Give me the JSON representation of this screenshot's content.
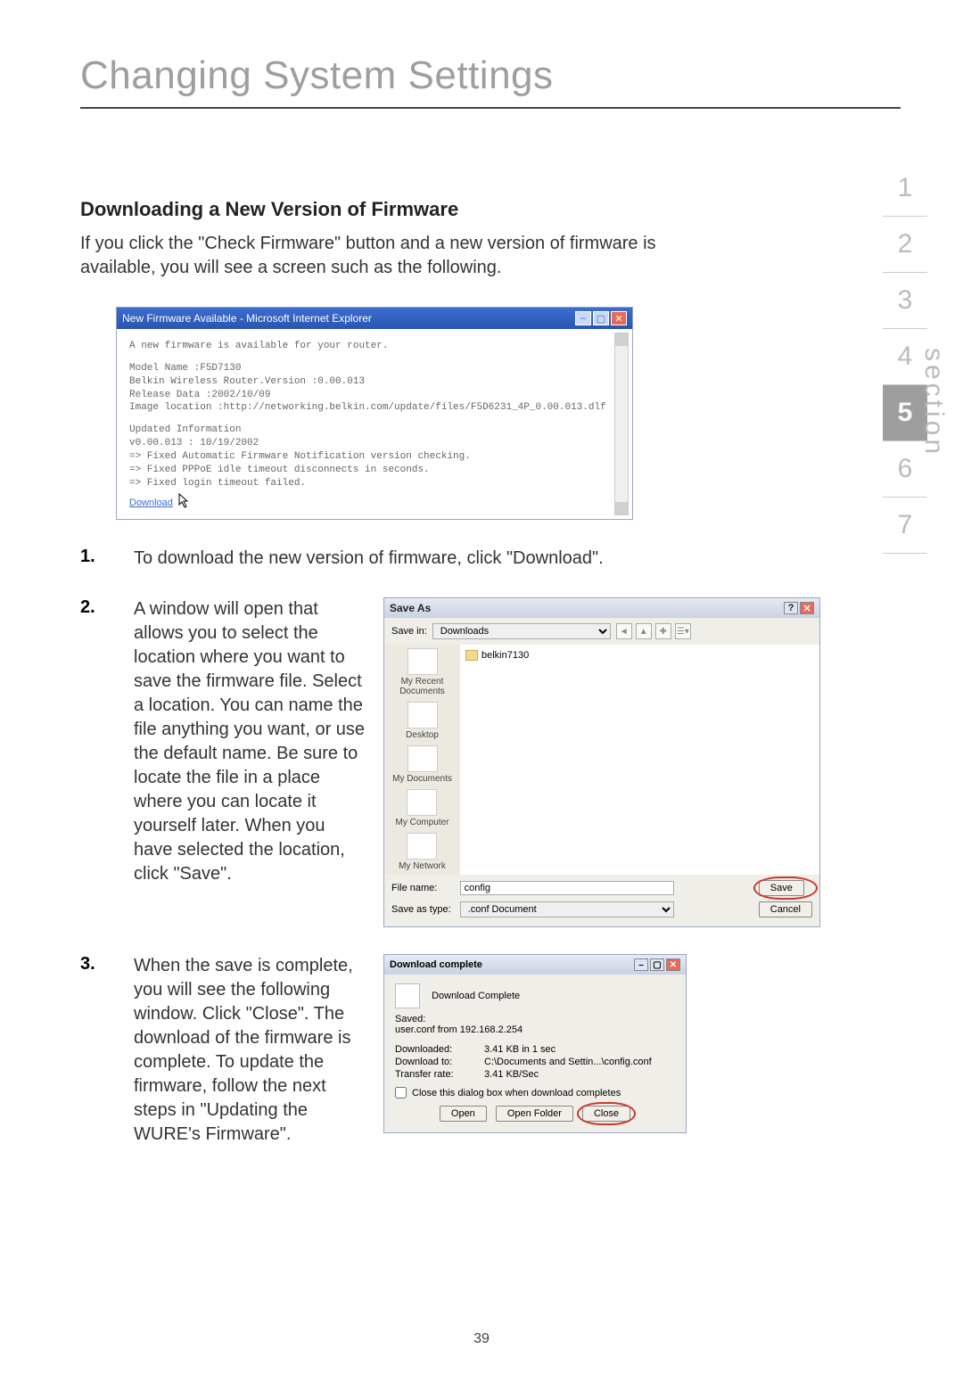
{
  "page": {
    "title": "Changing System Settings",
    "number": "39"
  },
  "subheading": "Downloading a New Version of Firmware",
  "intro": "If you click the \"Check Firmware\" button and a new version of firmware is available, you will see a screen such as the following.",
  "browser": {
    "title": "New Firmware Available - Microsoft Internet Explorer",
    "lines": [
      "A new firmware is available for your router.",
      "",
      "Model Name :F5D7130",
      "Belkin Wireless Router.Version :0.00.013",
      "Release Data :2002/10/09",
      "Image location :http://networking.belkin.com/update/files/F5D6231_4P_0.00.013.dlf",
      "",
      "Updated Information",
      "v0.00.013 : 10/19/2002",
      "=> Fixed Automatic Firmware Notification version checking.",
      "=> Fixed PPPoE idle timeout disconnects in seconds.",
      "=> Fixed login timeout failed."
    ],
    "download_link": "Download"
  },
  "steps": {
    "s1": "To download the new version of firmware, click \"Download\".",
    "s2": "A window will open that allows you to select the location where you want to save the firmware file. Select a location. You can name the file anything you want, or use the default name. Be sure to locate the file in a place where you can locate it yourself later. When you have selected the location, click \"Save\".",
    "s3": "When the save is complete, you will see the following window. Click \"Close\". The download of the firmware is complete. To update the firmware, follow the next steps in \"Updating the WURE's Firmware\"."
  },
  "saveas": {
    "title": "Save As",
    "savein_label": "Save in:",
    "savein_value": "Downloads",
    "folder_item": "belkin7130",
    "places": [
      "My Recent Documents",
      "Desktop",
      "My Documents",
      "My Computer",
      "My Network"
    ],
    "filename_label": "File name:",
    "filename_value": "config",
    "type_label": "Save as type:",
    "type_value": ".conf Document",
    "save_btn": "Save",
    "cancel_btn": "Cancel"
  },
  "dl": {
    "title": "Download complete",
    "heading": "Download Complete",
    "saved_label": "Saved:",
    "saved_value": "user.conf from 192.168.2.254",
    "rows": {
      "downloaded_label": "Downloaded:",
      "downloaded_value": "3.41 KB in 1 sec",
      "to_label": "Download to:",
      "to_value": "C:\\Documents and Settin...\\config.conf",
      "rate_label": "Transfer rate:",
      "rate_value": "3.41 KB/Sec"
    },
    "checkbox": "Close this dialog box when download completes",
    "open": "Open",
    "open_folder": "Open Folder",
    "close": "Close"
  },
  "sections": [
    "1",
    "2",
    "3",
    "4",
    "5",
    "6",
    "7"
  ],
  "section_label": "section"
}
